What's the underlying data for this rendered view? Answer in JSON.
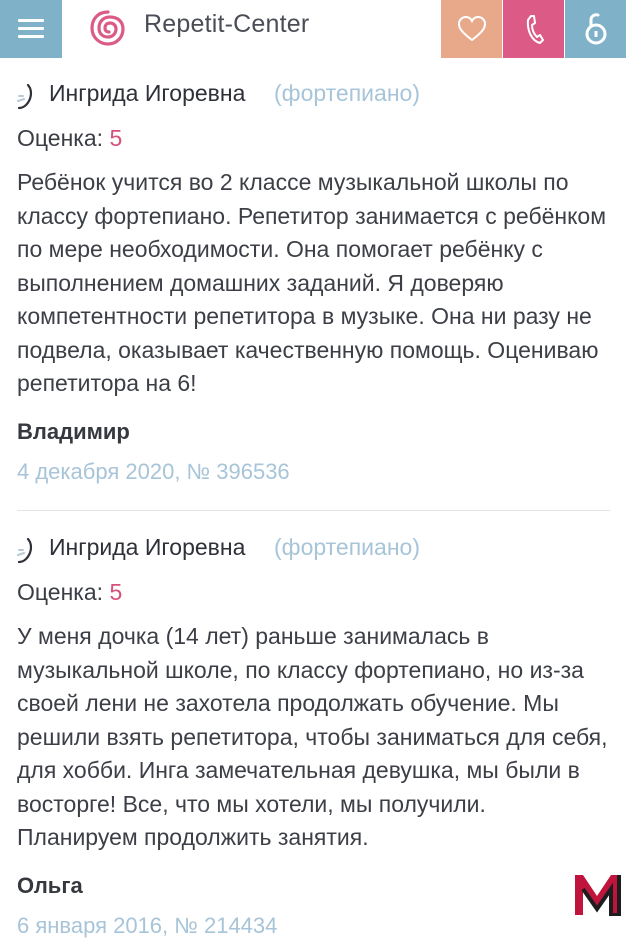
{
  "header": {
    "brand": "Repetit-Center",
    "icons": [
      "menu-icon",
      "logo-spiral",
      "heart-icon",
      "phone-icon",
      "login-icon"
    ],
    "colors": {
      "menu": "#7fb1c9",
      "heart": "#e8a98b",
      "phone": "#dc5b86",
      "login": "#7fb1c9",
      "logo": "#dc5b86"
    }
  },
  "reviews": [
    {
      "teacher": "Ингрида Игоревна",
      "subject": "(фортепиано)",
      "rating_label": "Оценка:",
      "rating_value": "5",
      "text": "Ребёнок учится во 2 классе музыкальной школы по классу фортепиано. Репетитор занимается с ребёнком по мере необходимости. Она помогает ребёнку с выполнением домашних заданий. Я доверяю компетентности репетитора в музыке. Она ни разу не подвела, оказывает качественную помощь. Оцениваю репетитора на 6!",
      "author": "Владимир",
      "meta": "4 декабря 2020, № 396536"
    },
    {
      "teacher": "Ингрида Игоревна",
      "subject": "(фортепиано)",
      "rating_label": "Оценка:",
      "rating_value": "5",
      "text": "У меня дочка (14 лет) раньше занималась в музыкальной школе, по классу фортепиано, но из-за своей лени не захотела продолжать обучение. Мы решили взять репетитора, чтобы заниматься для себя, для хобби. Инга замечательная девушка, мы были в восторге! Все, что мы хотели, мы получили. Планируем продолжить занятия.",
      "author": "Ольга",
      "meta": "6 января 2016, № 214434"
    }
  ],
  "colors": {
    "accent_pink": "#d5527a",
    "muted_blue": "#a7c4d8",
    "text": "#3c3f46"
  }
}
